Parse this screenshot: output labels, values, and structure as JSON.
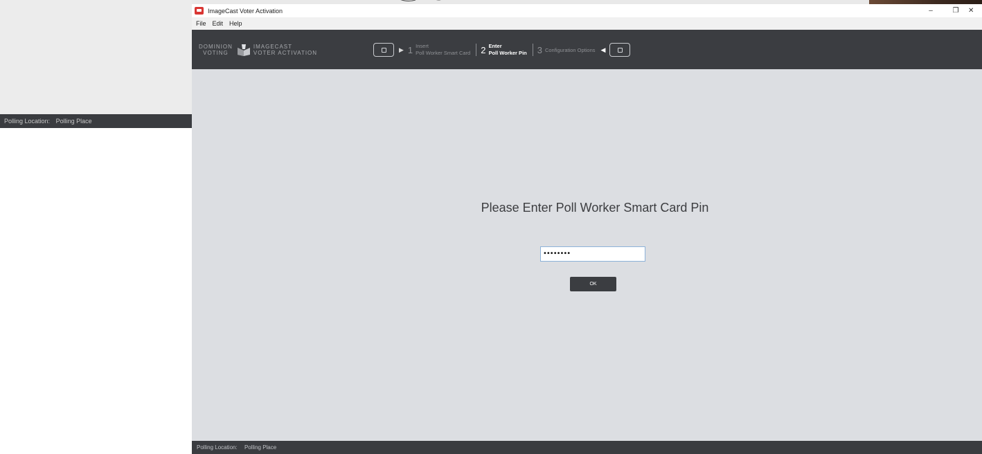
{
  "background": {
    "status_label": "Polling Location:",
    "status_value": "Polling Place"
  },
  "window": {
    "title": "ImageCast Voter Activation",
    "controls": {
      "minimize": "–",
      "restore": "❐",
      "close": "✕"
    }
  },
  "menu": [
    "File",
    "Edit",
    "Help"
  ],
  "header": {
    "logo_left_line1": "DOMINION",
    "logo_left_line2": "VOTING",
    "logo_right_line1": "IMAGECAST",
    "logo_right_line2": "VOTER ACTIVATION",
    "steps": [
      {
        "number": "1",
        "line1": "Insert",
        "line2": "Poll Worker Smart Card",
        "state": "inactive"
      },
      {
        "number": "2",
        "line1": "Enter",
        "line2": "Poll Worker Pin",
        "state": "active"
      },
      {
        "number": "3",
        "line1": "Configuration Options",
        "line2": "",
        "state": "inactive"
      }
    ]
  },
  "main": {
    "prompt": "Please Enter Poll Worker Smart Card Pin",
    "pin_value": "••••••••",
    "ok_label": "OK"
  },
  "status": {
    "label": "Polling Location:",
    "value": "Polling Place"
  },
  "colors": {
    "header_bg": "#3b3d41",
    "content_bg": "#dcdee2",
    "input_border": "#8cb2d9",
    "app_icon": "#d93633"
  }
}
